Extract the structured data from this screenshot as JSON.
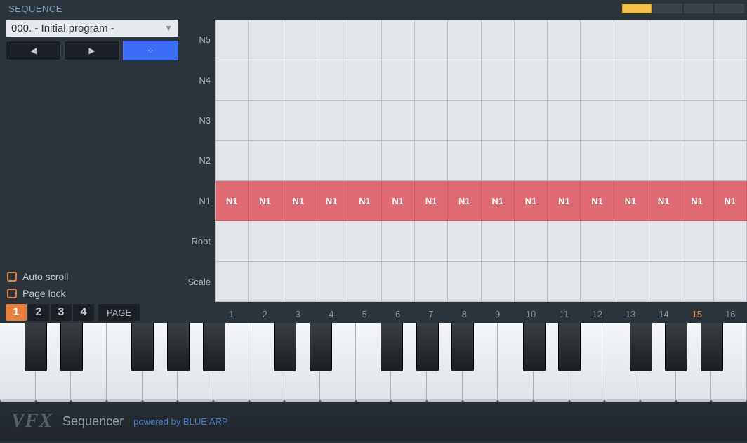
{
  "header": {
    "title": "SEQUENCE"
  },
  "program": {
    "selected": "000. - Initial program -"
  },
  "options": {
    "auto_scroll": "Auto scroll",
    "page_lock": "Page lock"
  },
  "rows": [
    "N5",
    "N4",
    "N3",
    "N2",
    "N1",
    "Root",
    "Scale"
  ],
  "active_row_label": "N1",
  "active_cell_text": "N1",
  "steps": [
    "1",
    "2",
    "3",
    "4",
    "5",
    "6",
    "7",
    "8",
    "9",
    "10",
    "11",
    "12",
    "13",
    "14",
    "15",
    "16"
  ],
  "highlight_step": "15",
  "pages": {
    "tabs": [
      "1",
      "2",
      "3",
      "4"
    ],
    "active": "1",
    "label": "PAGE"
  },
  "piano": {
    "white_count": 21
  },
  "footer": {
    "logo": "VFX",
    "name": "Sequencer",
    "credit": "powered by BLUE ARP"
  }
}
